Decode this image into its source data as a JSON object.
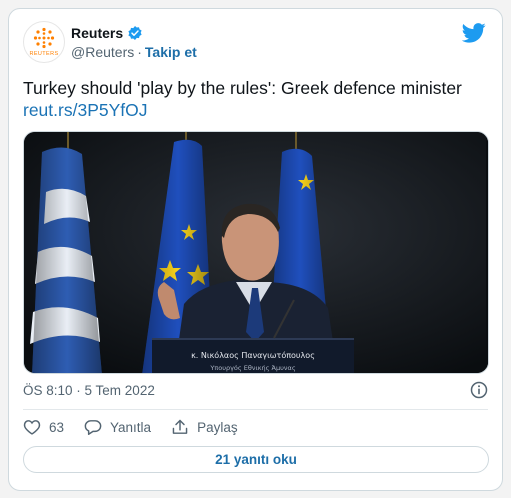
{
  "account": {
    "name": "Reuters",
    "handle": "@Reuters",
    "separator": "·",
    "follow_label": "Takip et",
    "avatar_logo_text": "REUTERS",
    "verified": true
  },
  "tweet": {
    "text": "Turkey should 'play by the rules': Greek defence minister",
    "link": "reut.rs/3P5YfOJ",
    "image": {
      "podium_name": "κ. Νικόλαος Παναγιωτόπουλος",
      "podium_title": "Υπουργός Εθνικής Άμυνας"
    },
    "timestamp": "ÖS 8:10 · 5 Tem 2022"
  },
  "actions": {
    "like_count": "63",
    "reply_label": "Yanıtla",
    "share_label": "Paylaş"
  },
  "replies_button": "21 yanıtı oku",
  "icons": {
    "bird": "twitter-bird-icon",
    "verified": "verified-badge-icon",
    "info": "info-icon",
    "like": "heart-icon",
    "reply": "speech-bubble-icon",
    "share": "share-upload-icon"
  },
  "colors": {
    "twitter_blue": "#1d9bf0",
    "link_blue": "#1b73b5",
    "reuters_orange": "#ff8000"
  }
}
